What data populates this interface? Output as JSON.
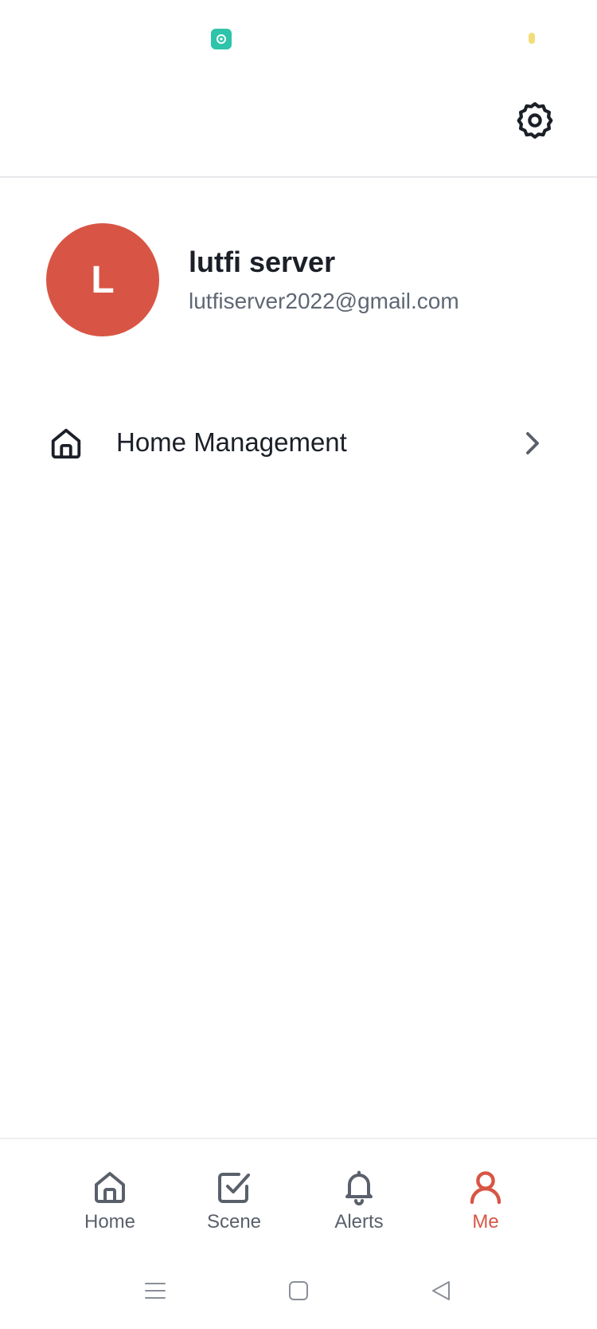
{
  "profile": {
    "avatar_initial": "L",
    "name": "lutfi server",
    "email": "lutfiserver2022@gmail.com"
  },
  "menu": {
    "items": [
      {
        "label": "Home Management",
        "icon": "home-icon"
      }
    ]
  },
  "tabs": [
    {
      "label": "Home",
      "icon": "home-icon",
      "active": false
    },
    {
      "label": "Scene",
      "icon": "checkbox-icon",
      "active": false
    },
    {
      "label": "Alerts",
      "icon": "bell-icon",
      "active": false
    },
    {
      "label": "Me",
      "icon": "user-icon",
      "active": true
    }
  ],
  "colors": {
    "accent": "#d85545",
    "text_primary": "#1b1f27",
    "text_secondary": "#5f6774",
    "tab_inactive": "#5a606b",
    "status_app_icon": "#2ec4a9"
  }
}
